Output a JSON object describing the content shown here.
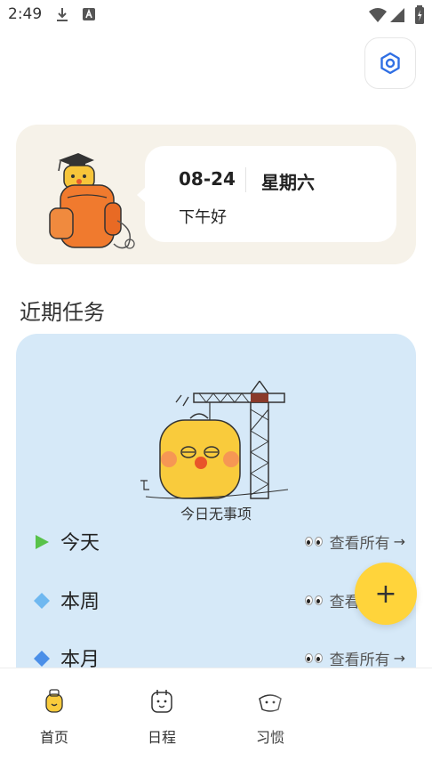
{
  "status_bar": {
    "time": "2:49",
    "icons": [
      "download-icon",
      "app-a-icon",
      "wifi-icon",
      "signal-icon",
      "battery-charging-icon"
    ]
  },
  "header": {
    "settings_icon": "hexagon-settings-icon",
    "accent_color": "#2f6fe4"
  },
  "greeting_card": {
    "date": "08-24",
    "weekday": "星期六",
    "greeting": "下午好",
    "background_color": "#f6f2e9"
  },
  "recent_tasks": {
    "title": "近期任务",
    "empty_text": "今日无事项",
    "card_color": "#d6e9f8",
    "periods": [
      {
        "label": "今天",
        "marker": "green-triangle-icon",
        "marker_color": "#58c24a",
        "view_all": "查看所有"
      },
      {
        "label": "本周",
        "marker": "blue-diamond-icon",
        "marker_color": "#6fb8f0",
        "view_all": "查看所有"
      },
      {
        "label": "本月",
        "marker": "blue-diamond-icon",
        "marker_color": "#4b8fe8",
        "view_all": "查看所有"
      }
    ]
  },
  "fab": {
    "label": "+",
    "color": "#ffd43b"
  },
  "bottom_nav": {
    "items": [
      {
        "label": "首页",
        "icon": "home-icon"
      },
      {
        "label": "日程",
        "icon": "calendar-icon"
      },
      {
        "label": "习惯",
        "icon": "habit-icon"
      }
    ]
  }
}
